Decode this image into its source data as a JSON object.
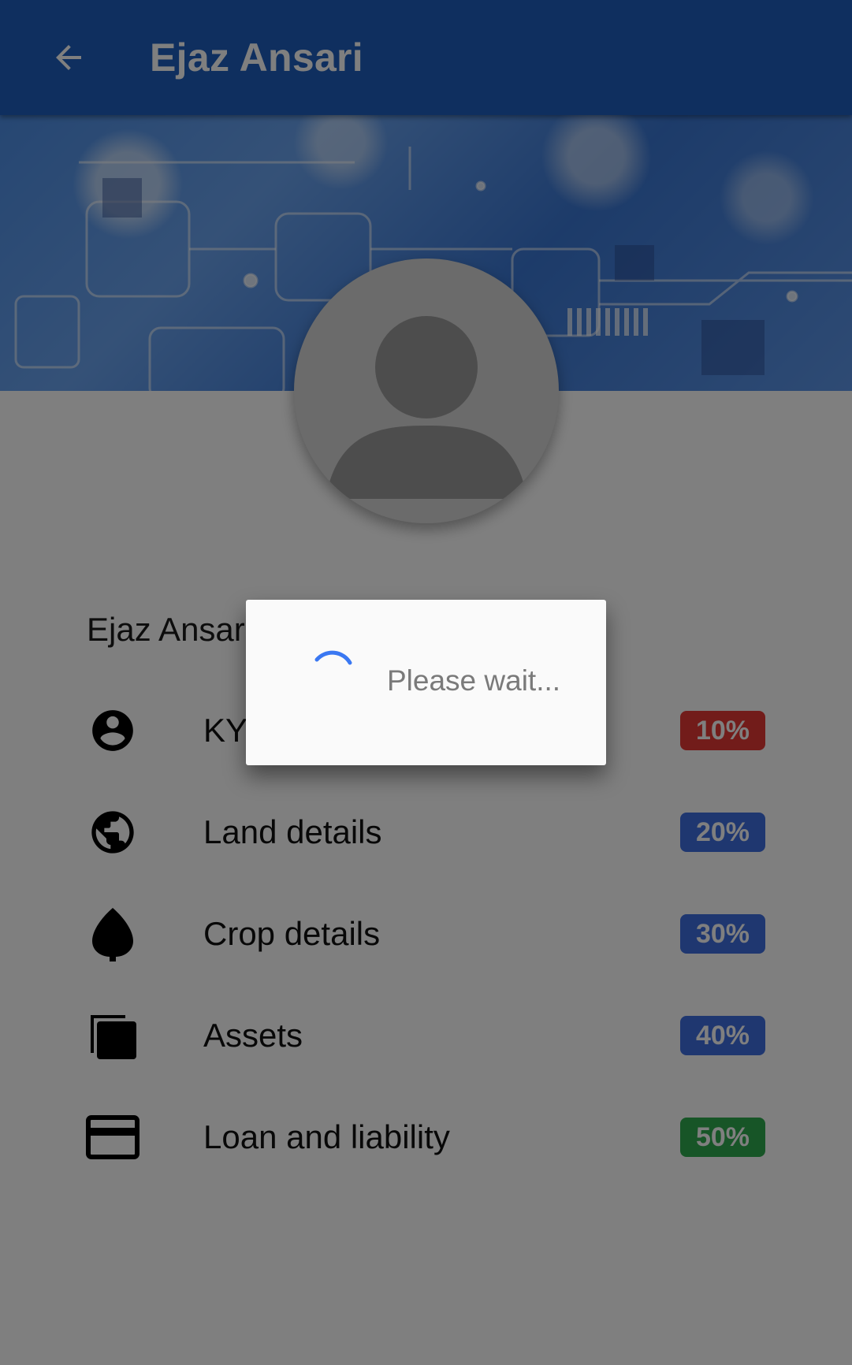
{
  "appbar": {
    "title": "Ejaz Ansari",
    "back_icon": "arrow-back-icon"
  },
  "profile": {
    "name": "Ejaz Ansari",
    "avatar_icon": "person-placeholder-icon"
  },
  "sections": [
    {
      "label": "KYC",
      "progress": "10%",
      "color": "#e53935",
      "icon": "account-circle-icon"
    },
    {
      "label": "Land details",
      "progress": "20%",
      "color": "#3f6fe0",
      "icon": "globe-icon"
    },
    {
      "label": "Crop details",
      "progress": "30%",
      "color": "#3f6fe0",
      "icon": "leaf-icon"
    },
    {
      "label": "Assets",
      "progress": "40%",
      "color": "#3f6fe0",
      "icon": "stacked-cards-icon"
    },
    {
      "label": "Loan and liability",
      "progress": "50%",
      "color": "#2eaa4e",
      "icon": "credit-card-icon"
    }
  ],
  "dialog": {
    "message": "Please wait...",
    "spinner_color": "#3a78f2"
  },
  "colors": {
    "appbar": "#1f5fbf",
    "overlay": "rgba(0,0,0,0.5)"
  }
}
